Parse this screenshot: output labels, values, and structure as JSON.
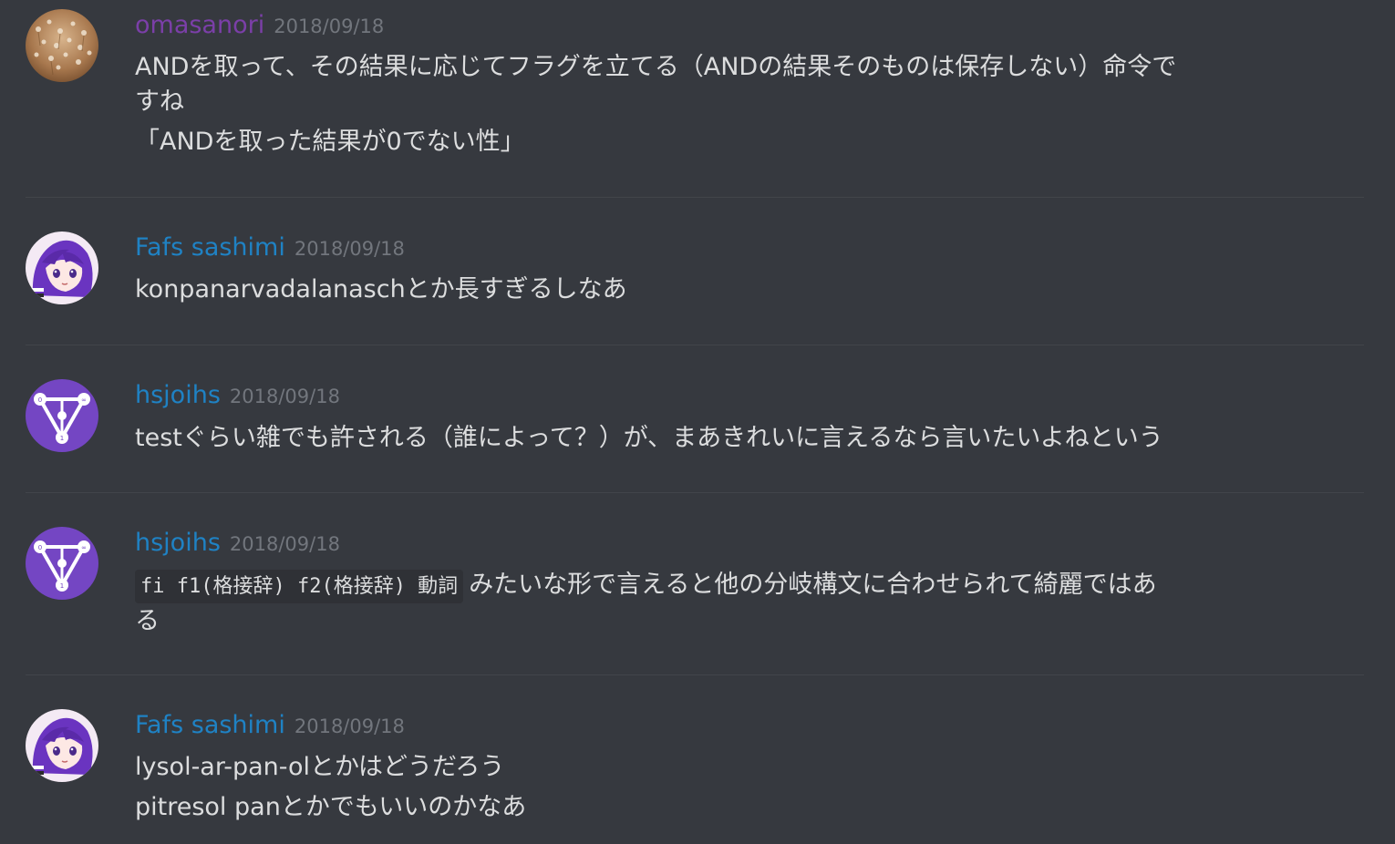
{
  "colors": {
    "background": "#36393f",
    "divider": "#42454a",
    "text": "#dcddde",
    "timestamp": "#72767d",
    "username_purple": "#7b3fa8",
    "username_blue": "#1f82c4"
  },
  "messages": [
    {
      "username": "omasanori",
      "timestamp": "2018/09/18",
      "avatar": "field-photo-avatar",
      "lines": [
        "ANDを取って、その結果に応じてフラグを立てる（ANDの結果そのものは保存しない）命令で",
        "すね",
        "「ANDを取った結果が0でない性」"
      ]
    },
    {
      "username": "Fafs sashimi",
      "timestamp": "2018/09/18",
      "avatar": "anime-girl-avatar",
      "lines": [
        "konpanarvadalanaschとか長すぎるしなあ"
      ]
    },
    {
      "username": "hsjoihs",
      "timestamp": "2018/09/18",
      "avatar": "triangle-logo-avatar",
      "lines": [
        "testぐらい雑でも許される（誰によって？）が、まあきれいに言えるなら言いたいよねという"
      ]
    },
    {
      "username": "hsjoihs",
      "timestamp": "2018/09/18",
      "avatar": "triangle-logo-avatar",
      "code": "fi f1(格接辞) f2(格接辞) 動詞",
      "lines": [
        "みたいな形で言えると他の分岐構文に合わせられて綺麗ではあ",
        "る"
      ]
    },
    {
      "username": "Fafs sashimi",
      "timestamp": "2018/09/18",
      "avatar": "anime-girl-avatar",
      "lines": [
        "lysol-ar-pan-olとかはどうだろう",
        "pitresol panとかでもいいのかなあ"
      ]
    }
  ]
}
